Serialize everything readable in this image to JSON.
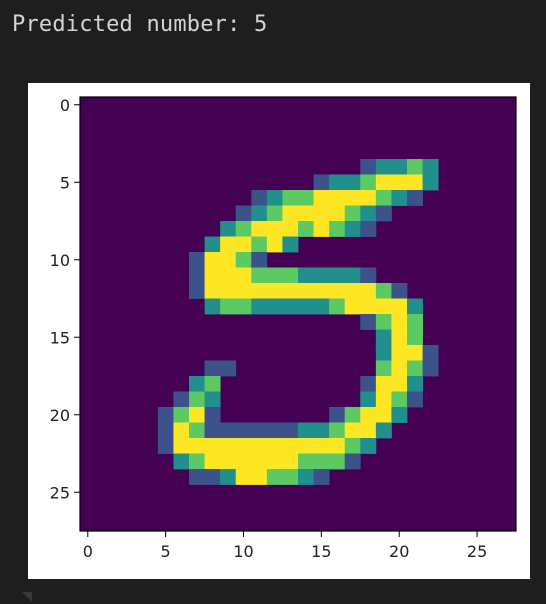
{
  "output": {
    "text": "Predicted number: 5"
  },
  "chart_data": {
    "type": "heatmap",
    "title": "",
    "xlabel": "",
    "ylabel": "",
    "xlim": [
      -0.5,
      27.5
    ],
    "ylim": [
      27.5,
      -0.5
    ],
    "grid": false,
    "legend": "none",
    "colormap": [
      "#440154",
      "#3b528b",
      "#21908d",
      "#5dc963",
      "#fde725"
    ],
    "xticks": [
      0,
      5,
      10,
      15,
      20,
      25
    ],
    "yticks": [
      0,
      5,
      10,
      15,
      20,
      25
    ],
    "xtick_labels": [
      "0",
      "5",
      "10",
      "15",
      "20",
      "25"
    ],
    "ytick_labels": [
      "0",
      "5",
      "10",
      "15",
      "20",
      "25"
    ],
    "values": [
      [
        0,
        0,
        0,
        0,
        0,
        0,
        0,
        0,
        0,
        0,
        0,
        0,
        0,
        0,
        0,
        0,
        0,
        0,
        0,
        0,
        0,
        0,
        0,
        0,
        0,
        0,
        0,
        0
      ],
      [
        0,
        0,
        0,
        0,
        0,
        0,
        0,
        0,
        0,
        0,
        0,
        0,
        0,
        0,
        0,
        0,
        0,
        0,
        0,
        0,
        0,
        0,
        0,
        0,
        0,
        0,
        0,
        0
      ],
      [
        0,
        0,
        0,
        0,
        0,
        0,
        0,
        0,
        0,
        0,
        0,
        0,
        0,
        0,
        0,
        0,
        0,
        0,
        0,
        0,
        0,
        0,
        0,
        0,
        0,
        0,
        0,
        0
      ],
      [
        0,
        0,
        0,
        0,
        0,
        0,
        0,
        0,
        0,
        0,
        0,
        0,
        0,
        0,
        0,
        0,
        0,
        0,
        0,
        0,
        0,
        0,
        0,
        0,
        0,
        0,
        0,
        0
      ],
      [
        0,
        0,
        0,
        0,
        0,
        0,
        0,
        0,
        0,
        0,
        0,
        0,
        0,
        0,
        0,
        0,
        0,
        0,
        1,
        2,
        2,
        3,
        2,
        0,
        0,
        0,
        0,
        0
      ],
      [
        0,
        0,
        0,
        0,
        0,
        0,
        0,
        0,
        0,
        0,
        0,
        0,
        0,
        0,
        0,
        1,
        2,
        2,
        3,
        4,
        4,
        4,
        2,
        0,
        0,
        0,
        0,
        0
      ],
      [
        0,
        0,
        0,
        0,
        0,
        0,
        0,
        0,
        0,
        0,
        0,
        1,
        2,
        3,
        3,
        4,
        4,
        4,
        4,
        3,
        2,
        1,
        0,
        0,
        0,
        0,
        0,
        0
      ],
      [
        0,
        0,
        0,
        0,
        0,
        0,
        0,
        0,
        0,
        0,
        1,
        2,
        3,
        4,
        4,
        4,
        4,
        3,
        2,
        1,
        0,
        0,
        0,
        0,
        0,
        0,
        0,
        0
      ],
      [
        0,
        0,
        0,
        0,
        0,
        0,
        0,
        0,
        0,
        2,
        3,
        4,
        4,
        4,
        3,
        4,
        3,
        2,
        1,
        0,
        0,
        0,
        0,
        0,
        0,
        0,
        0,
        0
      ],
      [
        0,
        0,
        0,
        0,
        0,
        0,
        0,
        0,
        2,
        4,
        4,
        3,
        4,
        2,
        0,
        0,
        0,
        0,
        0,
        0,
        0,
        0,
        0,
        0,
        0,
        0,
        0,
        0
      ],
      [
        0,
        0,
        0,
        0,
        0,
        0,
        0,
        1,
        4,
        4,
        3,
        1,
        0,
        0,
        0,
        0,
        0,
        0,
        0,
        0,
        0,
        0,
        0,
        0,
        0,
        0,
        0,
        0
      ],
      [
        0,
        0,
        0,
        0,
        0,
        0,
        0,
        1,
        4,
        4,
        4,
        3,
        3,
        3,
        2,
        2,
        2,
        2,
        1,
        0,
        0,
        0,
        0,
        0,
        0,
        0,
        0,
        0
      ],
      [
        0,
        0,
        0,
        0,
        0,
        0,
        0,
        1,
        4,
        4,
        4,
        4,
        4,
        4,
        4,
        4,
        4,
        4,
        4,
        3,
        1,
        0,
        0,
        0,
        0,
        0,
        0,
        0
      ],
      [
        0,
        0,
        0,
        0,
        0,
        0,
        0,
        0,
        2,
        3,
        3,
        2,
        2,
        2,
        2,
        2,
        3,
        4,
        4,
        4,
        4,
        2,
        0,
        0,
        0,
        0,
        0,
        0
      ],
      [
        0,
        0,
        0,
        0,
        0,
        0,
        0,
        0,
        0,
        0,
        0,
        0,
        0,
        0,
        0,
        0,
        0,
        0,
        1,
        3,
        4,
        3,
        0,
        0,
        0,
        0,
        0,
        0
      ],
      [
        0,
        0,
        0,
        0,
        0,
        0,
        0,
        0,
        0,
        0,
        0,
        0,
        0,
        0,
        0,
        0,
        0,
        0,
        0,
        2,
        4,
        3,
        0,
        0,
        0,
        0,
        0,
        0
      ],
      [
        0,
        0,
        0,
        0,
        0,
        0,
        0,
        0,
        0,
        0,
        0,
        0,
        0,
        0,
        0,
        0,
        0,
        0,
        0,
        2,
        4,
        4,
        1,
        0,
        0,
        0,
        0,
        0,
        0
      ],
      [
        0,
        0,
        0,
        0,
        0,
        0,
        0,
        0,
        1,
        1,
        0,
        0,
        0,
        0,
        0,
        0,
        0,
        0,
        0,
        3,
        4,
        3,
        1,
        0,
        0,
        0,
        0,
        0
      ],
      [
        0,
        0,
        0,
        0,
        0,
        0,
        0,
        2,
        3,
        0,
        0,
        0,
        0,
        0,
        0,
        0,
        0,
        0,
        1,
        4,
        4,
        2,
        0,
        0,
        0,
        0,
        0,
        0
      ],
      [
        0,
        0,
        0,
        0,
        0,
        0,
        1,
        3,
        2,
        0,
        0,
        0,
        0,
        0,
        0,
        0,
        0,
        0,
        2,
        4,
        3,
        1,
        0,
        0,
        0,
        0,
        0,
        0
      ],
      [
        0,
        0,
        0,
        0,
        0,
        1,
        3,
        4,
        1,
        0,
        0,
        0,
        0,
        0,
        0,
        0,
        1,
        3,
        4,
        4,
        2,
        0,
        0,
        0,
        0,
        0,
        0,
        0
      ],
      [
        0,
        0,
        0,
        0,
        0,
        1,
        4,
        3,
        1,
        1,
        1,
        1,
        1,
        1,
        2,
        2,
        3,
        4,
        4,
        2,
        0,
        0,
        0,
        0,
        0,
        0,
        0,
        0
      ],
      [
        0,
        0,
        0,
        0,
        0,
        1,
        4,
        4,
        4,
        4,
        4,
        4,
        4,
        4,
        4,
        4,
        4,
        3,
        2,
        0,
        0,
        0,
        0,
        0,
        0,
        0,
        0,
        0
      ],
      [
        0,
        0,
        0,
        0,
        0,
        0,
        2,
        3,
        4,
        4,
        4,
        4,
        4,
        4,
        3,
        3,
        3,
        1,
        0,
        0,
        0,
        0,
        0,
        0,
        0,
        0,
        0,
        0
      ],
      [
        0,
        0,
        0,
        0,
        0,
        0,
        0,
        1,
        1,
        2,
        4,
        4,
        3,
        3,
        2,
        1,
        0,
        0,
        0,
        0,
        0,
        0,
        0,
        0,
        0,
        0,
        0,
        0
      ],
      [
        0,
        0,
        0,
        0,
        0,
        0,
        0,
        0,
        0,
        0,
        0,
        0,
        0,
        0,
        0,
        0,
        0,
        0,
        0,
        0,
        0,
        0,
        0,
        0,
        0,
        0,
        0,
        0
      ],
      [
        0,
        0,
        0,
        0,
        0,
        0,
        0,
        0,
        0,
        0,
        0,
        0,
        0,
        0,
        0,
        0,
        0,
        0,
        0,
        0,
        0,
        0,
        0,
        0,
        0,
        0,
        0,
        0
      ],
      [
        0,
        0,
        0,
        0,
        0,
        0,
        0,
        0,
        0,
        0,
        0,
        0,
        0,
        0,
        0,
        0,
        0,
        0,
        0,
        0,
        0,
        0,
        0,
        0,
        0,
        0,
        0,
        0
      ]
    ]
  }
}
